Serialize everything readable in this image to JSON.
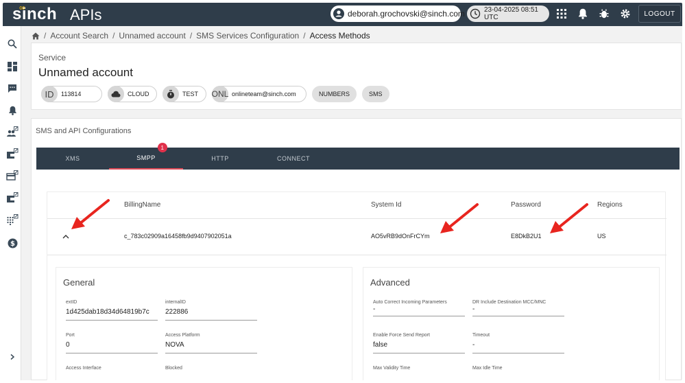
{
  "app": {
    "logo": "sinch",
    "title": "APIs"
  },
  "header": {
    "user_email": "deborah.grochovski@sinch.com",
    "datetime": "23-04-2025 08:51 UTC",
    "logout_label": "LOGOUT"
  },
  "breadcrumb": [
    "Account Search",
    "Unnamed account",
    "SMS Services Configuration",
    "Access Methods"
  ],
  "service": {
    "label": "Service",
    "account_name": "Unnamed account",
    "chips": [
      {
        "avatar": "ID",
        "text": "113814"
      },
      {
        "avatar_icon": "cloud-icon",
        "text": "CLOUD"
      },
      {
        "avatar_icon": "timer-icon",
        "text": "TEST"
      },
      {
        "avatar": "ONL",
        "text": "onlineteam@sinch.com"
      }
    ],
    "plain_chips": [
      "NUMBERS",
      "SMS"
    ]
  },
  "config": {
    "title": "SMS and API Configurations",
    "tabs": [
      {
        "label": "XMS"
      },
      {
        "label": "SMPP",
        "badge": "1",
        "active": true
      },
      {
        "label": "HTTP"
      },
      {
        "label": "CONNECT"
      }
    ],
    "table": {
      "headers": {
        "billing": "BillingName",
        "system": "System Id",
        "password": "Password",
        "regions": "Regions"
      },
      "row": {
        "billing": "c_783c02909a16458fb9d9407902051a",
        "system": "AO5vRB9dOnFrCYm",
        "password": "E8DkB2U1",
        "regions": "US"
      }
    },
    "general": {
      "title": "General",
      "fields": [
        {
          "label": "extID",
          "value": "1d425dab18d34d64819b7c"
        },
        {
          "label": "internalID",
          "value": "222886"
        },
        {
          "label": "Port",
          "value": "0"
        },
        {
          "label": "Access Platform",
          "value": "NOVA"
        },
        {
          "label": "Access Interface",
          "value": ""
        },
        {
          "label": "Blocked",
          "value": ""
        }
      ]
    },
    "advanced": {
      "title": "Advanced",
      "fields": [
        {
          "label": "Auto Correct Incoming Parameters",
          "value": "-"
        },
        {
          "label": "DR Include Destination MCC/MNC",
          "value": "-"
        },
        {
          "label": "Enable Force Send Report",
          "value": "false"
        },
        {
          "label": "Timeout",
          "value": "-"
        },
        {
          "label": "Max Validity Time",
          "value": ""
        },
        {
          "label": "Max Idle Time",
          "value": ""
        }
      ]
    }
  },
  "colors": {
    "topbar": "#2f3d4a",
    "brand": "#f5b800",
    "active_tab": "#e04b58",
    "badge": "#e0314b",
    "annotation_arrow": "#e8251f"
  }
}
